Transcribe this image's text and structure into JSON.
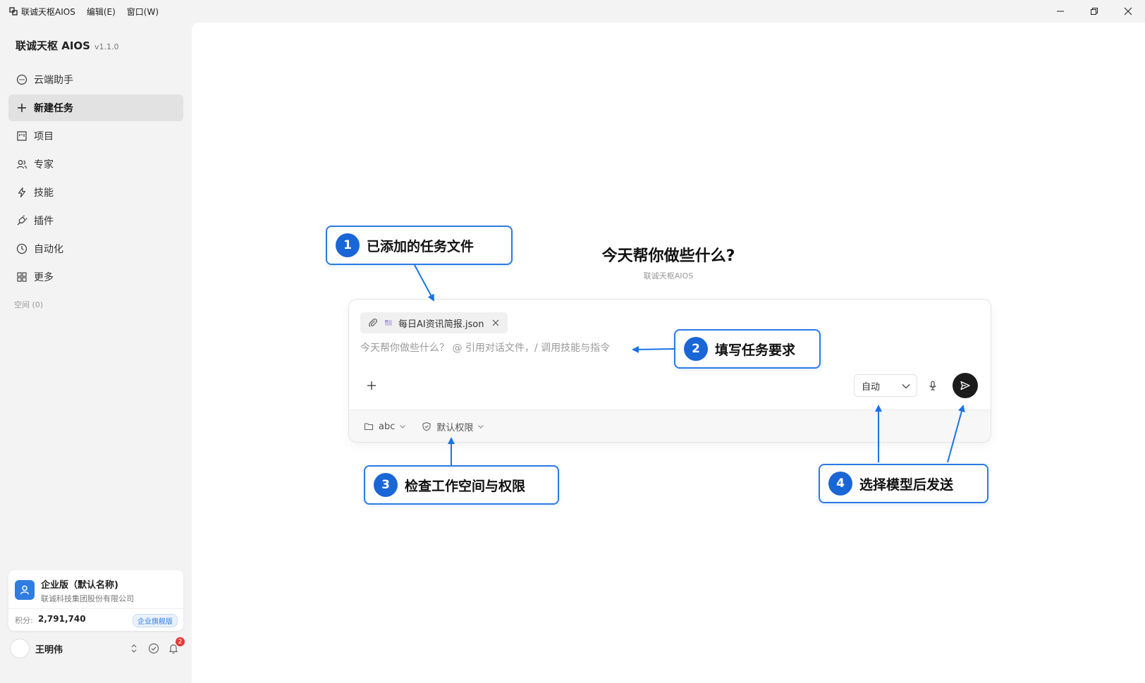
{
  "window": {
    "app_menu": "联诚天枢AIOS",
    "menus": [
      "编辑(E)",
      "窗口(W)"
    ]
  },
  "sidebar": {
    "brand": "联诚天枢 AIOS",
    "version": "v1.1.0",
    "items": [
      {
        "label": "云端助手",
        "icon": "chat-bubble-icon"
      },
      {
        "label": "新建任务",
        "icon": "plus-icon"
      },
      {
        "label": "项目",
        "icon": "board-icon"
      },
      {
        "label": "专家",
        "icon": "people-icon"
      },
      {
        "label": "技能",
        "icon": "lightning-icon"
      },
      {
        "label": "插件",
        "icon": "plug-icon"
      },
      {
        "label": "自动化",
        "icon": "clock-icon"
      },
      {
        "label": "更多",
        "icon": "grid-icon"
      }
    ],
    "active_index": 1,
    "space_label": "空间 (0)",
    "org": {
      "title": "企业版（默认名称)",
      "subtitle": "联诚科技集团股份有限公司",
      "points_label": "积分:",
      "points": "2,791,740",
      "badge": "企业旗舰版"
    },
    "user": {
      "name": "王明伟",
      "notification_count": "2"
    }
  },
  "main": {
    "title": "今天帮你做些什么?",
    "subtitle": "联诚天枢AIOS",
    "composer": {
      "file_name": "每日AI资讯简报.json",
      "placeholder": "今天帮你做些什么？ @ 引用对话文件，/ 调用技能与指令",
      "model": "自动",
      "workspace": "abc",
      "permission": "默认权限"
    }
  },
  "callouts": [
    {
      "num": "1",
      "text": "已添加的任务文件"
    },
    {
      "num": "2",
      "text": "填写任务要求"
    },
    {
      "num": "3",
      "text": "检查工作空间与权限"
    },
    {
      "num": "4",
      "text": "选择模型后发送"
    }
  ],
  "colors": {
    "accent": "#2b7be3",
    "callout_number": "#1966d6",
    "send_button": "#1b1b1b",
    "badge_red": "#e53935"
  }
}
